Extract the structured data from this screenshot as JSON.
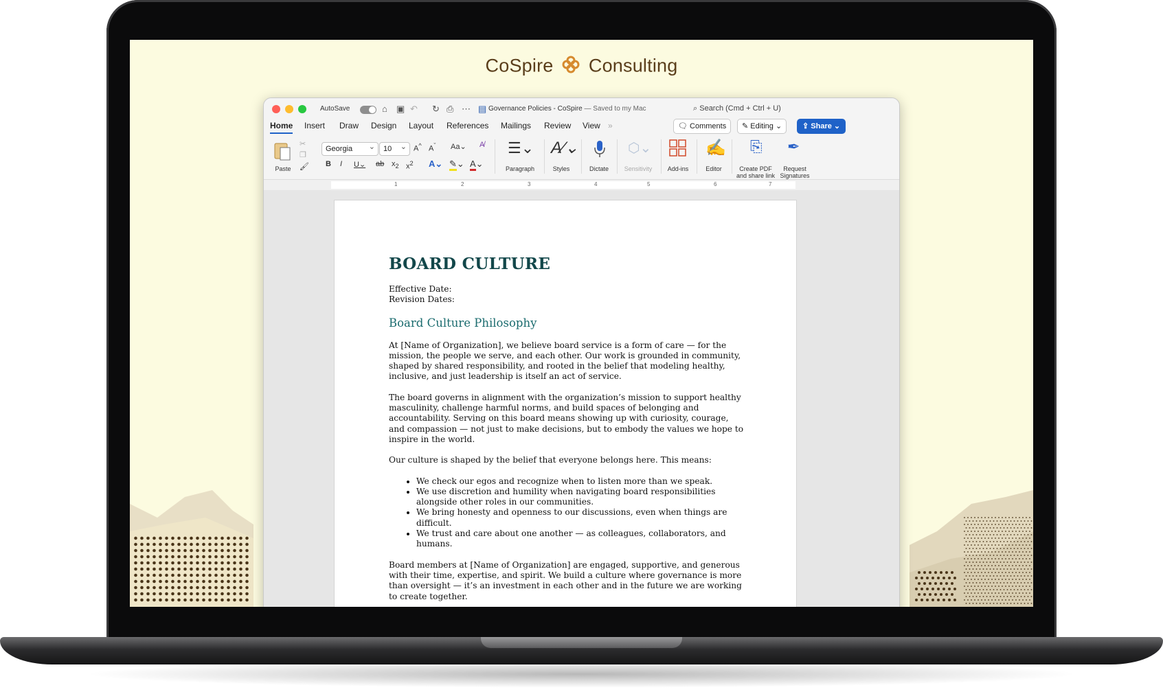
{
  "brand": {
    "name_left": "CoSpire",
    "name_right": "Consulting"
  },
  "window": {
    "autosave_label": "AutoSave",
    "doc_title": "Governance Policies - CoSpire",
    "saved_status": "— Saved to my Mac",
    "search_placeholder": "Search (Cmd + Ctrl + U)"
  },
  "tabs": [
    "Home",
    "Insert",
    "Draw",
    "Design",
    "Layout",
    "References",
    "Mailings",
    "Review",
    "View"
  ],
  "actions": {
    "comments": "Comments",
    "editing": "Editing",
    "share": "Share"
  },
  "ribbon": {
    "paste": "Paste",
    "font_name": "Georgia",
    "font_size": "10",
    "paragraph": "Paragraph",
    "styles": "Styles",
    "dictate": "Dictate",
    "sensitivity": "Sensitivity",
    "addins": "Add-ins",
    "editor": "Editor",
    "create_pdf": "Create PDF\nand share link",
    "request_signatures": "Request\nSignatures"
  },
  "ruler": {
    "numbers": [
      "1",
      "2",
      "3",
      "4",
      "5",
      "6",
      "7"
    ]
  },
  "document": {
    "heading": "BOARD CULTURE",
    "effective_date": "Effective Date:",
    "revision_dates": "Revision Dates:",
    "section_title": "Board Culture Philosophy",
    "para1": "At [Name of Organization], we believe board service is a form of care — for the mission, the people we serve, and each other. Our work is grounded in community, shaped by shared responsibility, and rooted in the belief that modeling healthy, inclusive, and just leadership is itself an act of service.",
    "para2": "The board governs in alignment with the organization’s mission to support healthy masculinity, challenge harmful norms, and build spaces of belonging and accountability. Serving on this board means showing up with curiosity, courage, and compassion — not just to make decisions, but to embody the values we hope to inspire in the world.",
    "para3": "Our culture is shaped by the belief that everyone belongs here. This means:",
    "bullets": [
      "We check our egos and recognize when to listen more than we speak.",
      "We use discretion and humility when navigating board responsibilities alongside other roles in our communities.",
      "We bring honesty and openness to our discussions, even when things are difficult.",
      "We trust and care about one another — as colleagues, collaborators, and humans."
    ],
    "para4": "Board members at [Name of Organization] are engaged, supportive, and generous with their time, expertise, and spirit. We build a culture where governance is more than oversight — it’s an investment in each other and in the future we are working to create together."
  }
}
